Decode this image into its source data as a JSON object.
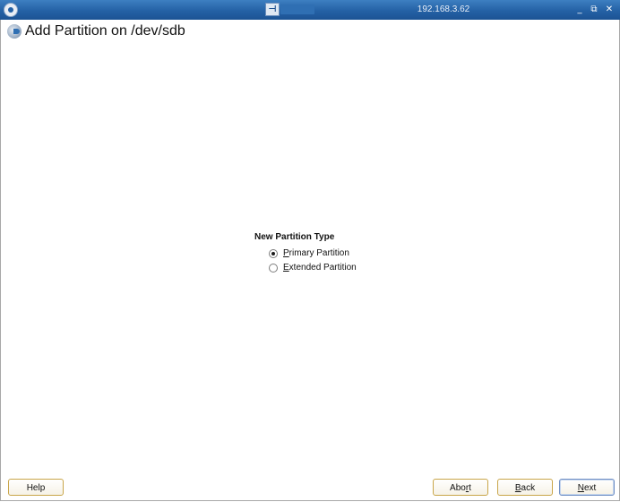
{
  "titlebar": {
    "title": "192.168.3.62",
    "pin_glyph": "⊣",
    "minimize_glyph": "_",
    "restore_glyph": "⧉",
    "close_glyph": "✕"
  },
  "dialog": {
    "heading": "Add Partition on /dev/sdb"
  },
  "partition_type": {
    "title": "New Partition Type",
    "options": [
      {
        "mnemonic": "P",
        "rest": "rimary Partition",
        "selected": true
      },
      {
        "mnemonic": "E",
        "rest": "xtended Partition",
        "selected": false
      }
    ]
  },
  "buttons": {
    "help": "Help",
    "abort_pre": "Abo",
    "abort_mn": "r",
    "abort_post": "t",
    "back_mn": "B",
    "back_post": "ack",
    "next_mn": "N",
    "next_post": "ext"
  },
  "icons": {
    "app_logo": "opensuse-logo-icon",
    "heading": "yast-partitioner-icon"
  },
  "colors": {
    "titlebar": "#2461a5",
    "button_border": "#c9a64a",
    "default_button_border": "#6f8fc4"
  }
}
